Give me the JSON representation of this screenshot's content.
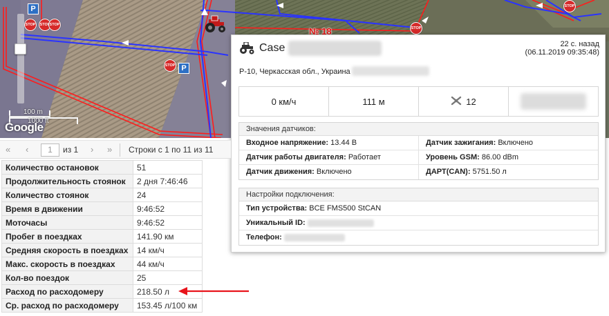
{
  "map": {
    "field_number": "№ 18",
    "scale_metric": "100 m",
    "scale_imperial": "1000 ft",
    "google_label": "Google",
    "stop_label": "STOP",
    "parking_label": "P",
    "route_color": "#2a33ff",
    "boundary_color": "#ff1b1b"
  },
  "popup": {
    "vehicle_name": "Case",
    "time_ago": "22 с. назад",
    "timestamp": "(06.11.2019 09:35:48)",
    "address": "Р-10, Черкасская обл., Украина",
    "metrics": {
      "speed": "0 км/ч",
      "altitude": "111 м",
      "satellites": "12"
    },
    "sensors": {
      "title": "Значения датчиков:",
      "rows": [
        [
          {
            "label": "Входное напряжение:",
            "value": "13.44 В"
          },
          {
            "label": "Датчик зажигания:",
            "value": "Включено"
          }
        ],
        [
          {
            "label": "Датчик работы двигателя:",
            "value": "Работает"
          },
          {
            "label": "Уровень GSM:",
            "value": "86.00 dBm"
          }
        ],
        [
          {
            "label": "Датчик движения:",
            "value": "Включено"
          },
          {
            "label": "ДАРТ(CAN):",
            "value": "5751.50 л"
          }
        ]
      ]
    },
    "connection": {
      "title": "Настройки подключения:",
      "device_type_label": "Тип устройства:",
      "device_type_value": "BCE FMS500 StCAN",
      "unique_id_label": "Уникальный ID:",
      "phone_label": "Телефон:"
    }
  },
  "pager": {
    "first": "«",
    "prev": "‹",
    "page": "1",
    "of": "из 1",
    "next": "›",
    "last": "»",
    "rows_info": "Строки с 1 по 11 из 11"
  },
  "stats": [
    {
      "label": "Количество остановок",
      "value": "51"
    },
    {
      "label": "Продолжительность стоянок",
      "value": "2 дня 7:46:46"
    },
    {
      "label": "Количество стоянок",
      "value": "24"
    },
    {
      "label": "Время в движении",
      "value": "9:46:52"
    },
    {
      "label": "Моточасы",
      "value": "9:46:52"
    },
    {
      "label": "Пробег в поездках",
      "value": "141.90 км"
    },
    {
      "label": "Средняя скорость в поездках",
      "value": "14 км/ч"
    },
    {
      "label": "Макс. скорость в поездках",
      "value": "44 км/ч"
    },
    {
      "label": "Кол-во поездок",
      "value": "25"
    },
    {
      "label": "Расход по расходомеру",
      "value": "218.50 л"
    },
    {
      "label": "Ср. расход по расходомеру",
      "value": "153.45 л/100 км"
    }
  ]
}
